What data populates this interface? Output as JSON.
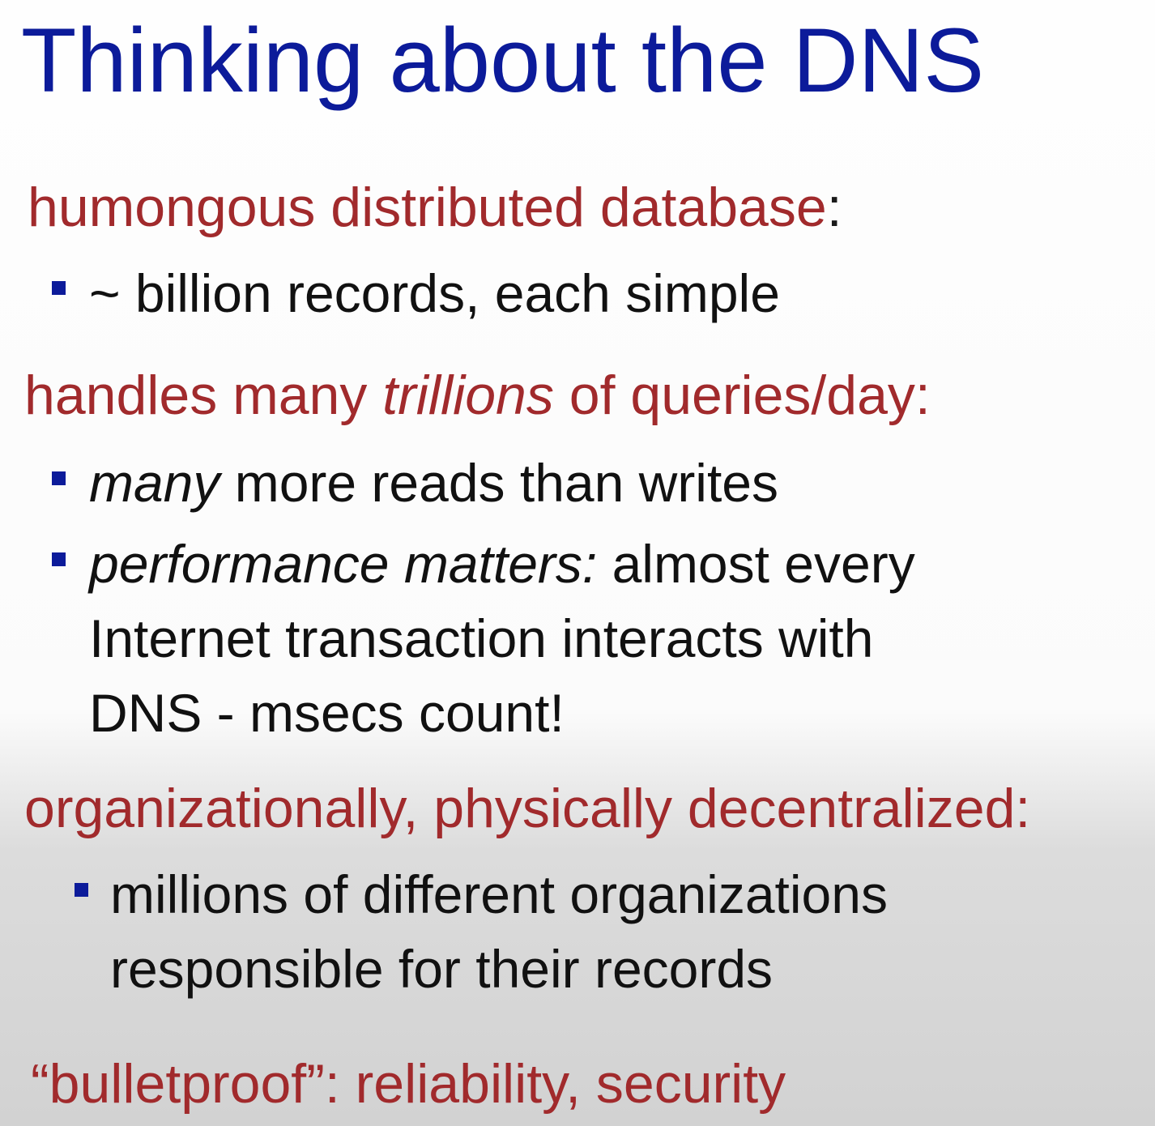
{
  "title": "Thinking about the DNS",
  "sections": [
    {
      "heading": "humongous distributed database",
      "colon": ":",
      "bullets": [
        {
          "text": "~ billion records, each simple"
        }
      ]
    },
    {
      "heading_pre": "handles many ",
      "heading_em": "trillions",
      "heading_post": " of queries/day:",
      "bullets": [
        {
          "em": "many",
          "text": " more reads than writes"
        },
        {
          "em": "performance matters:",
          "text": "  almost every",
          "line2": "Internet transaction interacts with",
          "line3": "DNS - msecs count!"
        }
      ]
    },
    {
      "heading": "organizationally, physically decentralized:",
      "bullets": [
        {
          "text": "millions of different organizations",
          "line2": "responsible for their records"
        }
      ]
    },
    {
      "heading": "“bulletproof”: reliability, security"
    }
  ],
  "colors": {
    "title": "#0c1b9a",
    "heading": "#a12a2c",
    "body": "#111111",
    "bullet": "#0c1b9a"
  }
}
